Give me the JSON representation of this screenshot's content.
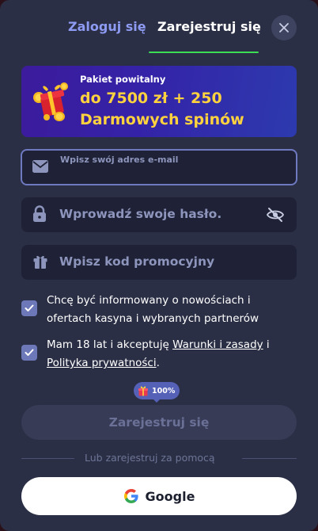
{
  "tabs": {
    "login": "Zaloguj się",
    "register": "Zarejestruj się"
  },
  "banner": {
    "subtitle": "Pakiet powitalny",
    "title": "do 7500 zł + 250 Darmowych spinów",
    "icon": "gift-with-coins-icon"
  },
  "form": {
    "email_placeholder": "Wpisz swój adres e-mail",
    "password_placeholder": "Wprowadź swoje hasło.",
    "promo_placeholder": "Wpisz kod promocyjny"
  },
  "consents": {
    "marketing": "Chcę być informowany o nowościach i ofertach kasyna i wybranych partnerów",
    "age_prefix": "Mam 18 lat i akceptuję ",
    "terms_link": "Warunki i zasady",
    "age_and": " i",
    "privacy_link": "Polityka prywatności",
    "age_suffix": "."
  },
  "progress": {
    "value": "100%",
    "fraction": 1.0
  },
  "buttons": {
    "submit": "Zarejestruj się",
    "google": "Google"
  },
  "divider": {
    "text": "Lub zarejestruj za pomocą"
  },
  "colors": {
    "modal_bg": "#2b2f45",
    "accent_green": "#3ddc56",
    "tab_inactive": "#8d9bf2",
    "banner_title": "#ffd23e",
    "checkbox": "#6d78b9"
  }
}
